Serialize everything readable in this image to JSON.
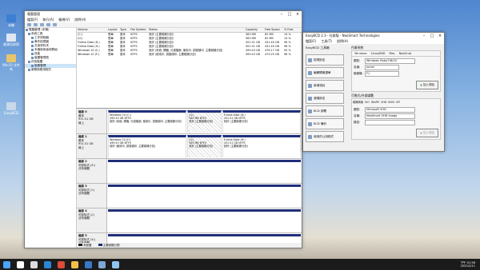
{
  "desktop": {
    "icons": [
      {
        "label": "本機",
        "icon": "computer-icon",
        "color": "#3d7fd0"
      },
      {
        "label": "資源回收筒",
        "icon": "recycle-bin-icon",
        "color": "#dfe8f0"
      },
      {
        "label": "Win10 文件夾",
        "icon": "folder-icon",
        "color": "#e9c46a"
      },
      {
        "label": "EasyBCD",
        "icon": "easybcd-icon",
        "color": "#c9d9ea"
      }
    ]
  },
  "diskmgmt": {
    "title": "電腦管理",
    "menu": [
      "檔案(F)",
      "執行(A)",
      "檢視(V)",
      "說明(H)"
    ],
    "tree": [
      "電腦管理 (本機)",
      "系統工具",
      "工作排程器",
      "事件檢視器",
      "共用資料夾",
      "本機使用者和群組",
      "效能",
      "裝置管理員",
      "存放裝置",
      "磁碟管理",
      "服務與應用程式"
    ],
    "columns": [
      "Volume",
      "Layout",
      "Type",
      "File System",
      "Status",
      "Capacity",
      "Free Space",
      "% Free"
    ],
    "rows": [
      [
        "(C:)",
        "簡單",
        "基本",
        "NTFS",
        "良好 (主要磁碟分割)",
        "583 MB",
        "82 MB",
        "14 %"
      ],
      [
        "(G:)",
        "簡單",
        "基本",
        "NTFS",
        "良好 (主要磁碟分割)",
        "583 MB",
        "82 MB",
        "14 %"
      ],
      [
        "Fuhkia Data (D:)",
        "簡單",
        "基本",
        "NTFS",
        "良好 (主要磁碟分割)",
        "451.51 GB",
        "431.40 GB",
        "96 %"
      ],
      [
        "Fuhkia Data (H:)",
        "簡單",
        "基本",
        "NTFS",
        "良好 (主要磁碟分割)",
        "451.51 GB",
        "431.40 GB",
        "96 %"
      ],
      [
        "Windows 10 (C:)",
        "簡單",
        "基本",
        "NTFS",
        "良好 (系統, 開機, 分頁檔案, 使用中, 損毀傾印, 主要磁碟分割)",
        "499.43 GB",
        "476.17 GB",
        "95 %"
      ],
      [
        "Windows 10 (F:)",
        "簡單",
        "基本",
        "NTFS",
        "良好 (使用中, 損毀傾印, 主要磁碟分割)",
        "499.43 GB",
        "479.25 GB",
        "96 %"
      ]
    ],
    "disks": [
      {
        "name": "磁碟 0",
        "type": "基本",
        "size": "931.51 GB",
        "state": "線上",
        "parts": [
          {
            "name": "Windows 10 (C:)",
            "size": "499.43 GB NTFS",
            "status": "良好 (系統, 開機, 分頁檔案, 使用中, 損毀傾印, 主要磁碟分割)"
          },
          {
            "name": "(G:)",
            "size": "583 MB NTFS",
            "status": "良好 (主要磁碟分割)"
          },
          {
            "name": "Fuhkia Data (D:)",
            "size": "431.51 GB NTFS",
            "status": "良好 (主要磁碟分割)"
          }
        ]
      },
      {
        "name": "磁碟 1",
        "type": "基本",
        "size": "931.51 GB",
        "state": "線上",
        "parts": [
          {
            "name": "Windows 10 (F:)",
            "size": "499.43 GB NTFS",
            "status": "良好 (使用中, 損毀傾印, 主要磁碟分割)"
          },
          {
            "name": "(G:)",
            "size": "583 MB NTFS",
            "status": "良好 (主要磁碟分割)"
          },
          {
            "name": "Fuhkia Data (H:)",
            "size": "431.51 GB NTFS",
            "status": "良好 (主要磁碟分割)"
          }
        ]
      },
      {
        "name": "磁碟 2",
        "type": "可卸除式 (E:)",
        "size": "",
        "state": "沒有媒體",
        "parts": []
      },
      {
        "name": "磁碟 3",
        "type": "可卸除式 (I:)",
        "size": "",
        "state": "沒有媒體",
        "parts": []
      },
      {
        "name": "磁碟 4",
        "type": "可卸除式 (J:)",
        "size": "",
        "state": "沒有媒體",
        "parts": []
      },
      {
        "name": "磁碟 5",
        "type": "可卸除式 (K:)",
        "size": "",
        "state": "沒有媒體",
        "parts": []
      }
    ],
    "legend": [
      {
        "label": "未配置",
        "color": "#222222"
      },
      {
        "label": "主要磁碟分割",
        "color": "#1f2f7a"
      }
    ]
  },
  "easybcd": {
    "title": "EasyBCD 2.3 - 社群版 - NeoSmart Technologies",
    "menu": [
      "檔案(F)",
      "工具(T)",
      "說明(H)"
    ],
    "section_label": "EasyBCD 工具箱",
    "buttons": [
      "檢視設定",
      "編輯開機選單",
      "新增項目",
      "進階設定",
      "BCD 部署",
      "BCD 備份",
      "使用的公用程式"
    ],
    "os_section": "作業系統",
    "os_tabs": [
      "Windows",
      "Linux/BSD",
      "Mac",
      "NeoGrub"
    ],
    "type_label": "類型:",
    "type_value": "Windows Vista/7/8/10",
    "name_label": "名稱:",
    "name_value": "Jumei",
    "drive_label": "磁碟機:",
    "drive_value": "F:\\",
    "add_button": "加入項目",
    "portable_section": "可攜式/外部媒體",
    "portable_tabs": [
      "磁碟映像",
      "ISO",
      "WinPE",
      "VHD",
      "BIOS",
      "EFI"
    ],
    "ptype_label": "類型:",
    "ptype_value": "Microsoft VHD",
    "pname_label": "名稱:",
    "pname_value": "NeoSmart VHD Image",
    "path_label": "路徑:",
    "path_value": "",
    "add_button2": "加入項目"
  },
  "taskbar": {
    "time": "下午 01:58",
    "date": "2020/2/11",
    "apps": [
      {
        "icon": "start-icon",
        "color": "#4ba3ff"
      },
      {
        "icon": "search-icon",
        "color": "#ffffff"
      },
      {
        "icon": "task-view-icon",
        "color": "#dddddd"
      },
      {
        "icon": "edge-icon",
        "color": "#2f86d6"
      },
      {
        "icon": "chrome-icon",
        "color": "#dd4b3a"
      },
      {
        "icon": "file-explorer-icon",
        "color": "#f3c14b"
      },
      {
        "icon": "store-icon",
        "color": "#3a78c4"
      },
      {
        "icon": "computer-management-icon",
        "color": "#7fa6d4"
      },
      {
        "icon": "easybcd-taskbar-icon",
        "color": "#90c4ef"
      }
    ]
  }
}
